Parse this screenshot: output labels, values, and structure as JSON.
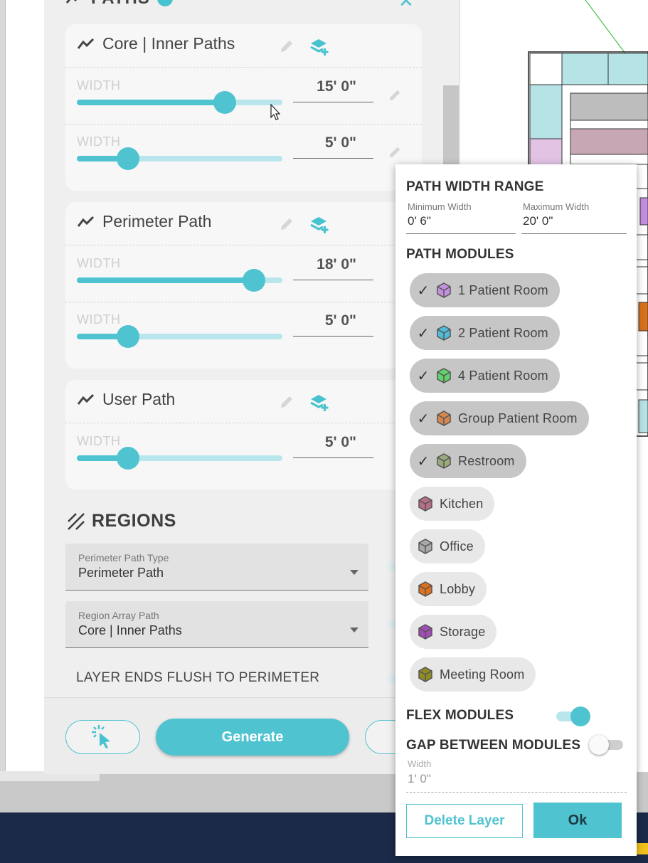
{
  "panel": {
    "title": "PATHS",
    "paths": [
      {
        "name": "Core | Inner Paths",
        "rows": [
          {
            "label": "WIDTH",
            "value": "15'  0\"",
            "slider_fraction": 0.72
          },
          {
            "label": "WIDTH",
            "value": "5'  0\"",
            "slider_fraction": 0.25
          }
        ]
      },
      {
        "name": "Perimeter Path",
        "rows": [
          {
            "label": "WIDTH",
            "value": "18'  0\"",
            "slider_fraction": 0.86
          },
          {
            "label": "WIDTH",
            "value": "5'  0\"",
            "slider_fraction": 0.25
          }
        ]
      },
      {
        "name": "User Path",
        "rows": [
          {
            "label": "WIDTH",
            "value": "5'  0\"",
            "slider_fraction": 0.25
          }
        ]
      }
    ],
    "regions": {
      "title": "REGIONS",
      "perimeter_path_type": {
        "label": "Perimeter Path Type",
        "value": "Perimeter Path"
      },
      "region_array_path": {
        "label": "Region Array Path",
        "value": "Core | Inner Paths"
      },
      "layer_ends_label": "LAYER ENDS FLUSH TO PERIMETER"
    },
    "footer": {
      "generate_label": "Generate"
    }
  },
  "popup": {
    "width_range_title": "PATH WIDTH RANGE",
    "min_width": {
      "label": "Minimum Width",
      "value": "0'  6\""
    },
    "max_width": {
      "label": "Maximum Width",
      "value": "20'  0\""
    },
    "modules_title": "PATH MODULES",
    "modules": [
      {
        "label": "1 Patient Room",
        "selected": true,
        "color": "#c58fdf"
      },
      {
        "label": "2 Patient Room",
        "selected": true,
        "color": "#52bcd8"
      },
      {
        "label": "4 Patient Room",
        "selected": true,
        "color": "#63d26a"
      },
      {
        "label": "Group Patient Room",
        "selected": true,
        "color": "#d5874f"
      },
      {
        "label": "Restroom",
        "selected": true,
        "color": "#9aaa7c"
      },
      {
        "label": "Kitchen",
        "selected": false,
        "color": "#b66f86"
      },
      {
        "label": "Office",
        "selected": false,
        "color": "#a9a9a9"
      },
      {
        "label": "Lobby",
        "selected": false,
        "color": "#e0711c"
      },
      {
        "label": "Storage",
        "selected": false,
        "color": "#a24bb6"
      },
      {
        "label": "Meeting Room",
        "selected": false,
        "color": "#8e8a25"
      }
    ],
    "flex_modules": {
      "label": "FLEX MODULES",
      "on": true
    },
    "gap_between": {
      "label": "GAP BETWEEN MODULES",
      "on": false,
      "width_label": "Width",
      "width_value": "1'  0\""
    },
    "delete_label": "Delete Layer",
    "ok_label": "Ok"
  },
  "colors": {
    "accent": "#4fc3cf",
    "accent_light": "#b9e6ec"
  }
}
